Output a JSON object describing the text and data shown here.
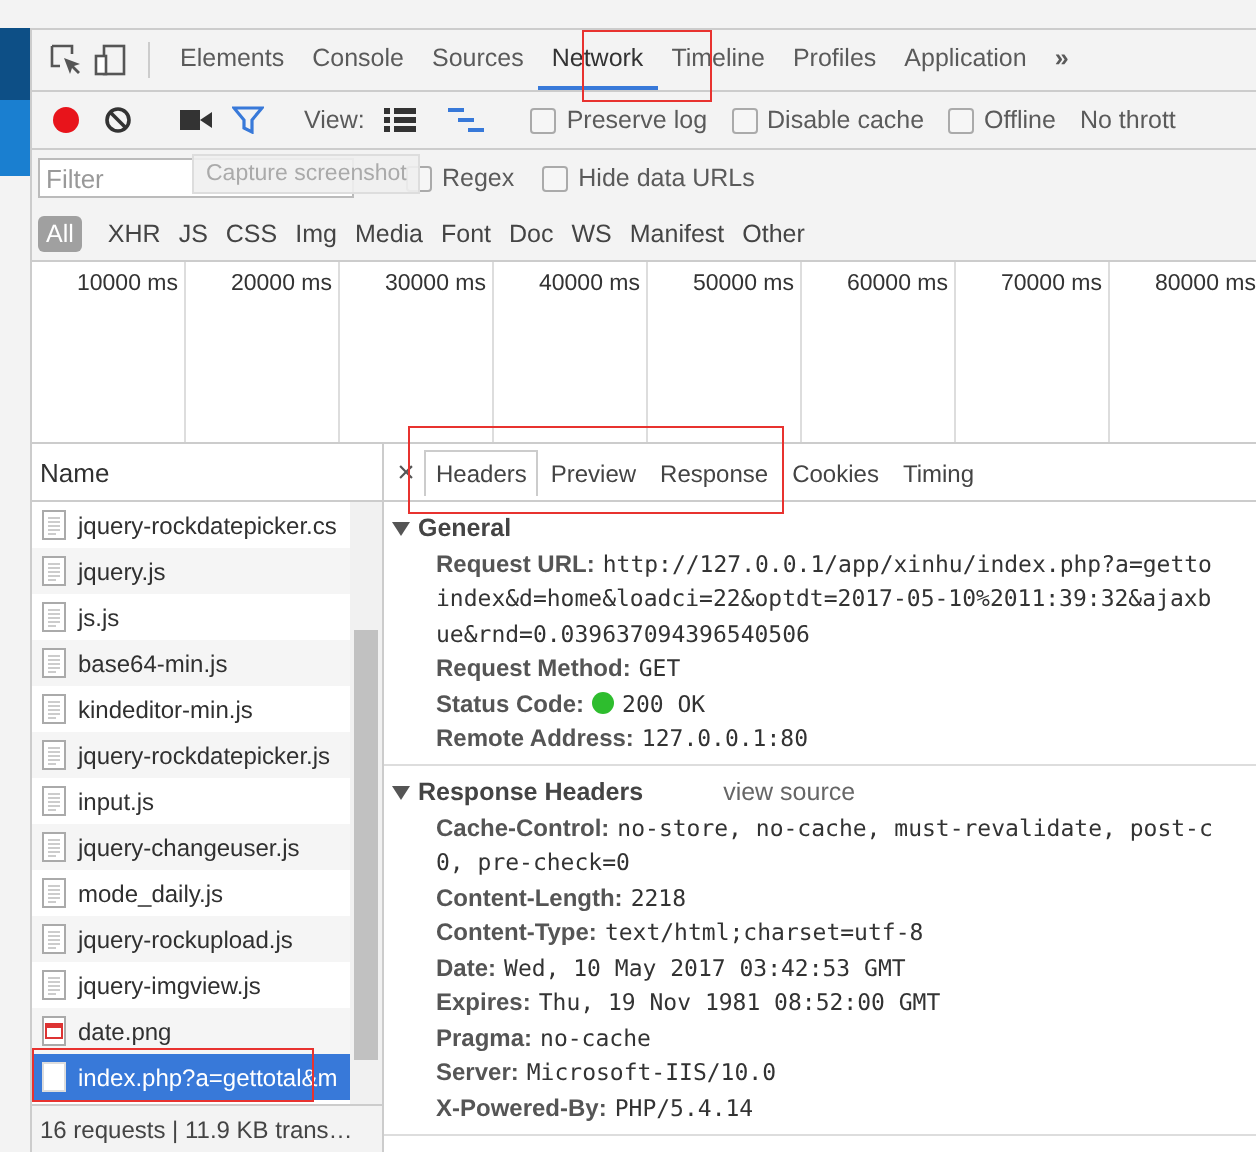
{
  "panel_tabs": [
    {
      "label": "Elements",
      "selected": false
    },
    {
      "label": "Console",
      "selected": false
    },
    {
      "label": "Sources",
      "selected": false
    },
    {
      "label": "Network",
      "selected": true
    },
    {
      "label": "Timeline",
      "selected": false
    },
    {
      "label": "Profiles",
      "selected": false
    },
    {
      "label": "Application",
      "selected": false
    }
  ],
  "more_tabs": "»",
  "toolbar": {
    "recording": true,
    "filter_on": true,
    "view_label": "View:",
    "views": [
      {
        "kind": "list",
        "selected": false
      },
      {
        "kind": "waterfall",
        "selected": true
      }
    ],
    "options": [
      {
        "label": "Preserve log",
        "checked": false
      },
      {
        "label": "Disable cache",
        "checked": false
      },
      {
        "label": "Offline",
        "checked": false
      }
    ],
    "throttle": "No thrott"
  },
  "filter": {
    "placeholder": "Filter",
    "tooltip": "Capture screenshot",
    "options": [
      {
        "label": "Regex",
        "checked": false
      },
      {
        "label": "Hide data URLs",
        "checked": false
      }
    ]
  },
  "types": [
    {
      "label": "All",
      "selected": true
    },
    {
      "label": "XHR",
      "selected": false
    },
    {
      "label": "JS",
      "selected": false
    },
    {
      "label": "CSS",
      "selected": false
    },
    {
      "label": "Img",
      "selected": false
    },
    {
      "label": "Media",
      "selected": false
    },
    {
      "label": "Font",
      "selected": false
    },
    {
      "label": "Doc",
      "selected": false
    },
    {
      "label": "WS",
      "selected": false
    },
    {
      "label": "Manifest",
      "selected": false
    },
    {
      "label": "Other",
      "selected": false
    }
  ],
  "timeline_ticks": [
    "10000 ms",
    "20000 ms",
    "30000 ms",
    "40000 ms",
    "50000 ms",
    "60000 ms",
    "70000 ms",
    "80000 ms"
  ],
  "requests": {
    "column": "Name",
    "rows": [
      {
        "name": "jquery-rockdatepicker.cs",
        "kind": "script",
        "selected": false
      },
      {
        "name": "jquery.js",
        "kind": "script",
        "selected": false
      },
      {
        "name": "js.js",
        "kind": "script",
        "selected": false
      },
      {
        "name": "base64-min.js",
        "kind": "script",
        "selected": false
      },
      {
        "name": "kindeditor-min.js",
        "kind": "script",
        "selected": false
      },
      {
        "name": "jquery-rockdatepicker.js",
        "kind": "script",
        "selected": false
      },
      {
        "name": "input.js",
        "kind": "script",
        "selected": false
      },
      {
        "name": "jquery-changeuser.js",
        "kind": "script",
        "selected": false
      },
      {
        "name": "mode_daily.js",
        "kind": "script",
        "selected": false
      },
      {
        "name": "jquery-rockupload.js",
        "kind": "script",
        "selected": false
      },
      {
        "name": "jquery-imgview.js",
        "kind": "script",
        "selected": false
      },
      {
        "name": "date.png",
        "kind": "image",
        "selected": false
      },
      {
        "name": "index.php?a=gettotal&m",
        "kind": "document",
        "selected": true
      }
    ],
    "status": "16 requests | 11.9 KB trans…"
  },
  "detail": {
    "close": "×",
    "tabs": [
      {
        "label": "Headers",
        "selected": true
      },
      {
        "label": "Preview",
        "selected": false
      },
      {
        "label": "Response",
        "selected": false
      },
      {
        "label": "Cookies",
        "selected": false
      },
      {
        "label": "Timing",
        "selected": false
      }
    ],
    "sections": [
      {
        "title": "General",
        "expanded": true,
        "rows": [
          {
            "key": "Request URL:",
            "lines": [
              "http://127.0.0.1/app/xinhu/index.php?a=getto",
              "index&d=home&loadci=22&optdt=2017-05-10%2011:39:32&ajaxb",
              "ue&rnd=0.039637094396540506"
            ]
          },
          {
            "key": "Request Method:",
            "lines": [
              "GET"
            ]
          },
          {
            "key": "Status Code:",
            "lines": [
              "200 OK"
            ],
            "color": "#2ebd2e"
          },
          {
            "key": "Remote Address:",
            "lines": [
              "127.0.0.1:80"
            ]
          }
        ]
      },
      {
        "title": "Response Headers",
        "link": "view source",
        "expanded": true,
        "rows": [
          {
            "key": "Cache-Control:",
            "lines": [
              "no-store, no-cache, must-revalidate, post-c",
              "0, pre-check=0"
            ]
          },
          {
            "key": "Content-Length:",
            "lines": [
              "2218"
            ]
          },
          {
            "key": "Content-Type:",
            "lines": [
              "text/html;charset=utf-8"
            ]
          },
          {
            "key": "Date:",
            "lines": [
              "Wed, 10 May 2017 03:42:53 GMT"
            ]
          },
          {
            "key": "Expires:",
            "lines": [
              "Thu, 19 Nov 1981 08:52:00 GMT"
            ]
          },
          {
            "key": "Pragma:",
            "lines": [
              "no-cache"
            ]
          },
          {
            "key": "Server:",
            "lines": [
              "Microsoft-IIS/10.0"
            ]
          },
          {
            "key": "X-Powered-By:",
            "lines": [
              "PHP/5.4.14"
            ]
          }
        ]
      }
    ]
  }
}
